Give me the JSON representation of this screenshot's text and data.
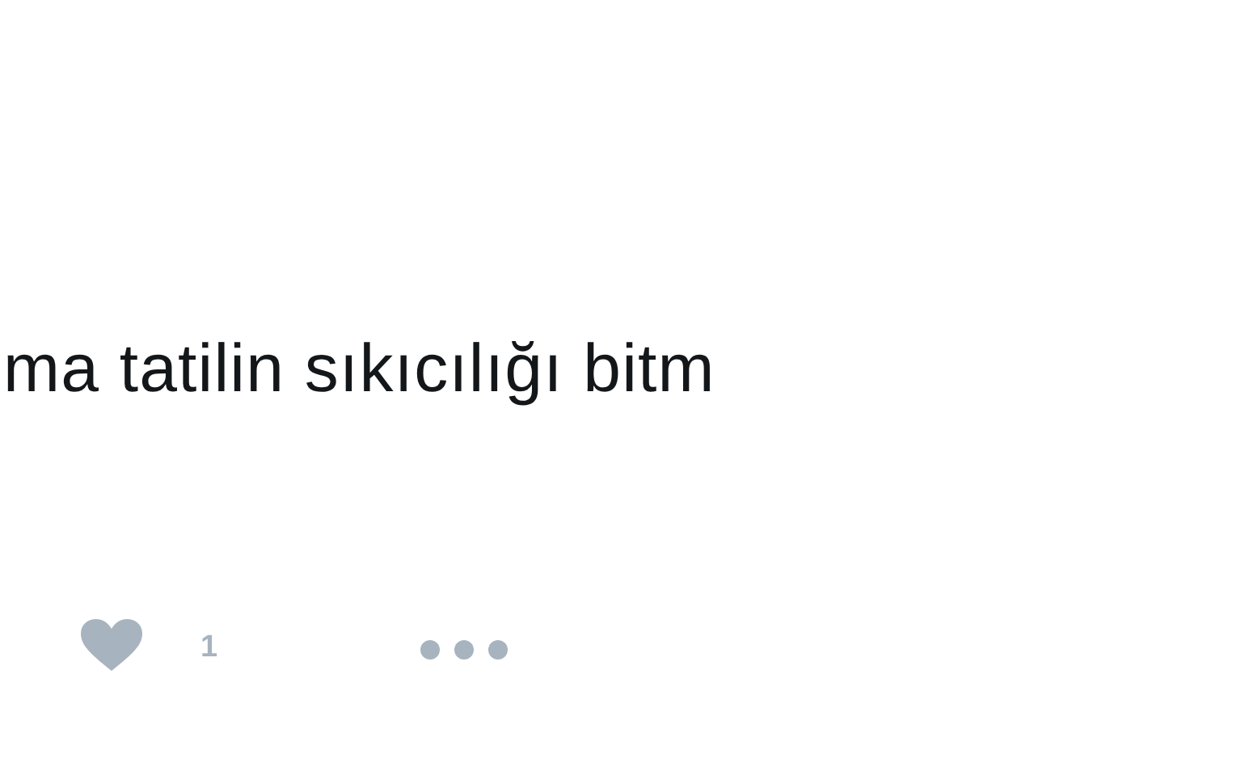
{
  "tweet": {
    "text": "ma tatilin sıkıcılığı bitm"
  },
  "actions": {
    "liked": false,
    "like_count": "1"
  }
}
